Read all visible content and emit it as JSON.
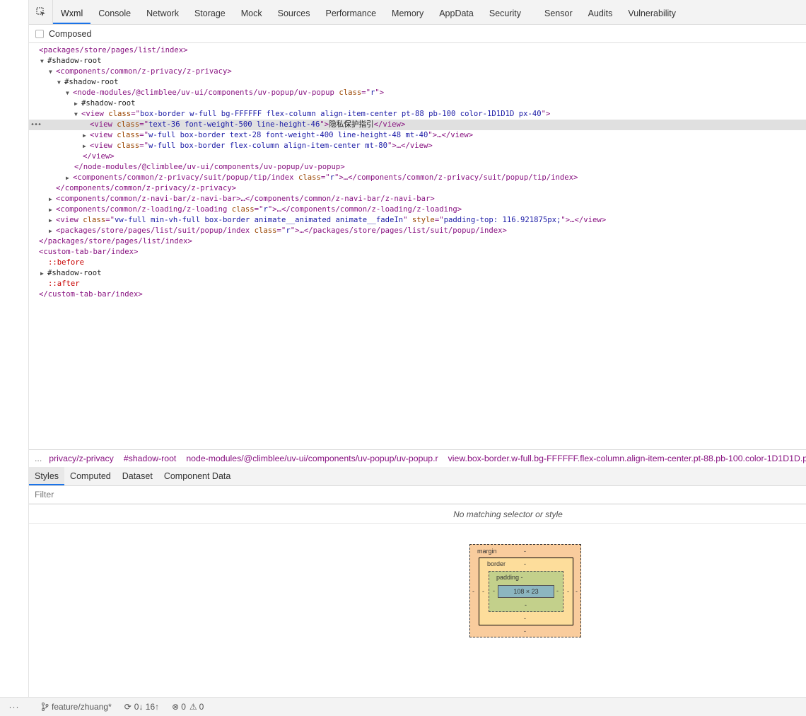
{
  "tabs": [
    "Wxml",
    "Console",
    "Network",
    "Storage",
    "Mock",
    "Sources",
    "Performance",
    "Memory",
    "AppData",
    "Security",
    "Sensor",
    "Audits",
    "Vulnerability"
  ],
  "composed_label": "Composed",
  "tree": {
    "r0": {
      "tag": "packages/store/pages/list/index"
    },
    "r1": {
      "text": "#shadow-root"
    },
    "r2": {
      "tag": "components/common/z-privacy/z-privacy"
    },
    "r3": {
      "text": "#shadow-root"
    },
    "r4": {
      "tag": "node-modules/@climblee/uv-ui/components/uv-popup/uv-popup",
      "attr": "class",
      "val": "r"
    },
    "r5": {
      "text": "#shadow-root"
    },
    "r6": {
      "tag": "view",
      "attr": "class",
      "val": "box-border w-full bg-FFFFFF flex-column align-item-center pt-88 pb-100 color-1D1D1D px-40"
    },
    "r7": {
      "tag": "view",
      "attr": "class",
      "val": "text-36 font-weight-500 line-height-46",
      "text": "隐私保护指引",
      "close": "view"
    },
    "r8": {
      "tag": "view",
      "attr": "class",
      "val": "w-full box-border text-28 font-weight-400 line-height-48 mt-40",
      "close": "view"
    },
    "r9": {
      "tag": "view",
      "attr": "class",
      "val": "w-full box-border flex-column align-item-center mt-80",
      "close": "view"
    },
    "r10": {
      "close": "view"
    },
    "r11": {
      "close": "node-modules/@climblee/uv-ui/components/uv-popup/uv-popup"
    },
    "r12": {
      "tag": "components/common/z-privacy/suit/popup/tip/index",
      "attr": "class",
      "val": "r",
      "close": "components/common/z-privacy/suit/popup/tip/index"
    },
    "r13": {
      "close": "components/common/z-privacy/z-privacy"
    },
    "r14": {
      "tag": "components/common/z-navi-bar/z-navi-bar",
      "close": "components/common/z-navi-bar/z-navi-bar"
    },
    "r15": {
      "tag": "components/common/z-loading/z-loading",
      "attr": "class",
      "val": "r",
      "close": "components/common/z-loading/z-loading"
    },
    "r16": {
      "tag": "view",
      "attr": "class",
      "val": "vw-full min-vh-full box-border animate__animated animate__fadeIn",
      "attr2": "style",
      "val2": "padding-top: 116.921875px;",
      "close": "view"
    },
    "r17": {
      "tag": "packages/store/pages/list/suit/popup/index",
      "attr": "class",
      "val": "r",
      "close": "packages/store/pages/list/suit/popup/index"
    },
    "r18": {
      "close": "packages/store/pages/list/index"
    },
    "r19": {
      "tag": "custom-tab-bar/index"
    },
    "r20": {
      "text": "::before"
    },
    "r21": {
      "text": "#shadow-root"
    },
    "r22": {
      "text": "::after"
    },
    "r23": {
      "close": "custom-tab-bar/index"
    }
  },
  "breadcrumbs": [
    "...",
    "privacy/z-privacy",
    "#shadow-root",
    "node-modules/@climblee/uv-ui/components/uv-popup/uv-popup.r",
    "view.box-border.w-full.bg-FFFFFF.flex-column.align-item-center.pt-88.pb-100.color-1D1D1D.p"
  ],
  "style_tabs": [
    "Styles",
    "Computed",
    "Dataset",
    "Component Data"
  ],
  "filter_placeholder": "Filter",
  "no_match": "No matching selector or style",
  "box_model": {
    "margin": "margin",
    "border": "border",
    "padding": "padding -",
    "content": "108 × 23",
    "dash": "-"
  },
  "statusbar": {
    "dots": "···",
    "branch": "feature/zhuang*",
    "sync": "0↓ 16↑",
    "errors": "0",
    "warnings": "0"
  }
}
